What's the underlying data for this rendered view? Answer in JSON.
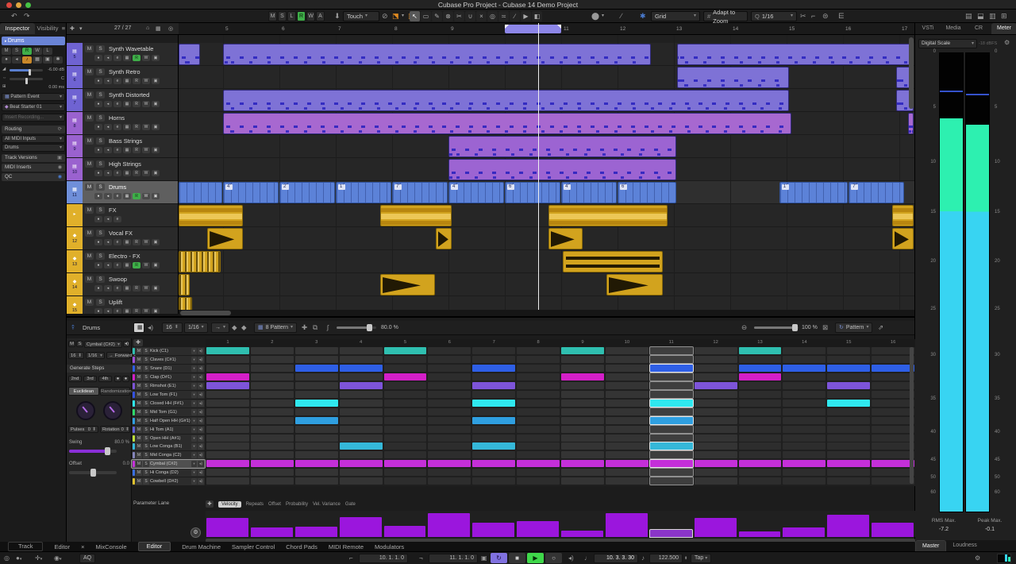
{
  "titlebar": {
    "title": "Cubase Pro Project - Cubase 14 Demo Project"
  },
  "toolbar": {
    "automation": [
      "M",
      "S",
      "L",
      "R",
      "W",
      "A"
    ],
    "active_automation_index": 3,
    "touch_mode": "Touch",
    "grid_mode": "Grid",
    "adapt_mode": "Adapt to Zoom",
    "quantize": "1/16",
    "tools": [
      {
        "name": "object-selection-tool",
        "glyph": "↖",
        "active": true
      },
      {
        "name": "range-selection-tool",
        "glyph": "▭",
        "active": false
      },
      {
        "name": "draw-tool",
        "glyph": "✎",
        "active": false
      },
      {
        "name": "erase-tool",
        "glyph": "⊗",
        "active": false
      },
      {
        "name": "split-tool",
        "glyph": "✂",
        "active": false
      },
      {
        "name": "glue-tool",
        "glyph": "∪",
        "active": false
      },
      {
        "name": "mute-tool",
        "glyph": "×",
        "active": false
      },
      {
        "name": "zoom-tool",
        "glyph": "◎",
        "active": false
      },
      {
        "name": "comp-tool",
        "glyph": "≍",
        "active": false
      },
      {
        "name": "line-tool",
        "glyph": "∕",
        "active": false
      },
      {
        "name": "play-tool",
        "glyph": "▶",
        "active": false
      },
      {
        "name": "color-tool",
        "glyph": "◧",
        "active": false
      }
    ]
  },
  "inspector": {
    "tab_inspector": "Inspector",
    "tab_visibility": "Visibility",
    "track_title": "Drums",
    "buttons": [
      "M",
      "S",
      "R",
      "W",
      "L"
    ],
    "buttons2": [
      "●",
      "◂",
      "♪",
      "▦",
      "▣",
      "✱"
    ],
    "volume": "-6.00 dB",
    "pan": "C",
    "delay": "0.00 ms",
    "pattern_event": "Pattern Event",
    "preset": "Beat Starter 01",
    "insert_recording": "Insert Recording...",
    "routing": "Routing",
    "input": "All MIDI Inputs",
    "output": "Drums",
    "track_versions": "Track Versions",
    "midi_inserts": "MIDI Inserts",
    "qc": "QC"
  },
  "project": {
    "counter": "27 / 27",
    "ruler_bars": [
      "5",
      "6",
      "7",
      "8",
      "9",
      "10",
      "11",
      "12",
      "13",
      "14",
      "15",
      "16",
      "17"
    ],
    "cycle": {
      "from": 10,
      "to": 11
    },
    "playhead_bar": 10.59,
    "ms": [
      "M",
      "S"
    ],
    "subs": [
      "●",
      "◂",
      "e",
      "▦",
      "R",
      "W",
      "▣"
    ],
    "tracks": [
      {
        "num": "5",
        "name": "Synth Wavetable",
        "color": "#6f63d2",
        "kind": "midi",
        "pcolor": "#7e72d6",
        "selected": false,
        "rec": true,
        "parts": [
          {
            "s": 4.17,
            "e": 4.6
          },
          {
            "s": 5,
            "e": 12.6
          },
          {
            "s": 13.05,
            "e": 17.27
          }
        ]
      },
      {
        "num": "6",
        "name": "Synth Retro",
        "color": "#6f63d2",
        "kind": "midi",
        "pcolor": "#7e72d6",
        "selected": false,
        "rec": false,
        "parts": [
          {
            "s": 13.05,
            "e": 15.05
          },
          {
            "s": 16.95,
            "e": 17.27
          }
        ]
      },
      {
        "num": "7",
        "name": "Synth Distorted",
        "color": "#6f63d2",
        "kind": "midi",
        "pcolor": "#7e72d6",
        "selected": false,
        "rec": false,
        "parts": [
          {
            "s": 5,
            "e": 15.05
          },
          {
            "s": 16.95,
            "e": 17.27
          }
        ]
      },
      {
        "num": "8",
        "name": "Horns",
        "color": "#9a62cf",
        "kind": "midi",
        "pcolor": "#a768d0",
        "selected": false,
        "rec": false,
        "parts": [
          {
            "s": 5,
            "e": 15.1
          },
          {
            "s": 17.15,
            "e": 17.27
          }
        ]
      },
      {
        "num": "9",
        "name": "Bass Strings",
        "color": "#9a62cf",
        "kind": "midi",
        "pcolor": "#9c64d2",
        "selected": false,
        "rec": false,
        "parts": [
          {
            "s": 9,
            "e": 13.05
          }
        ]
      },
      {
        "num": "10",
        "name": "High Strings",
        "color": "#9a62cf",
        "kind": "midi",
        "pcolor": "#9c64d2",
        "selected": false,
        "rec": false,
        "parts": [
          {
            "s": 9,
            "e": 13.05
          }
        ]
      },
      {
        "num": "11",
        "name": "Drums",
        "color": "#6f8fd9",
        "kind": "pattern",
        "pcolor": "#5c82d8",
        "selected": true,
        "rec": true,
        "parts": [
          {
            "s": 4.17,
            "e": 5
          },
          {
            "s": 5,
            "e": 6,
            "label": "4˚"
          },
          {
            "s": 6,
            "e": 7,
            "label": "2˚"
          },
          {
            "s": 7,
            "e": 8,
            "label": "1˚"
          },
          {
            "s": 8,
            "e": 9,
            "label": "7˚"
          },
          {
            "s": 9,
            "e": 10,
            "label": "4˚"
          },
          {
            "s": 10,
            "e": 11,
            "label": "6˚"
          },
          {
            "s": 11,
            "e": 12,
            "label": "4˚"
          },
          {
            "s": 12,
            "e": 13.05,
            "label": "6˚"
          },
          {
            "s": 14.87,
            "e": 16.1,
            "label": "1˚"
          },
          {
            "s": 16.1,
            "e": 17.1,
            "label": "7˚"
          }
        ]
      },
      {
        "num": "",
        "name": "FX",
        "color": "#e0b02a",
        "kind": "folder",
        "pcolor": "#d2a31e",
        "selected": false,
        "rec": false,
        "parts": [
          {
            "s": 4.17,
            "e": 5.37,
            "tex": "bands"
          },
          {
            "s": 7.79,
            "e": 9.07,
            "tex": "bands"
          },
          {
            "s": 10.77,
            "e": 12.9,
            "tex": "bands"
          },
          {
            "s": 16.87,
            "e": 17.27,
            "tex": "bands"
          }
        ]
      },
      {
        "num": "12",
        "name": "Vocal FX",
        "color": "#e0b02a",
        "kind": "audio",
        "pcolor": "#d2a31e",
        "selected": false,
        "rec": false,
        "parts": [
          {
            "s": 4.72,
            "e": 5.37,
            "tex": "wedge"
          },
          {
            "s": 8.77,
            "e": 9.07,
            "tex": "wedge"
          },
          {
            "s": 10.77,
            "e": 11.4,
            "tex": "wedge"
          },
          {
            "s": 16.87,
            "e": 17.27,
            "tex": "wedge"
          }
        ]
      },
      {
        "num": "13",
        "name": "Electro - FX",
        "color": "#e0b02a",
        "kind": "audio",
        "pcolor": "#d2a31e",
        "selected": false,
        "rec": true,
        "parts": [
          {
            "s": 4.17,
            "e": 4.97,
            "tex": "stripes"
          },
          {
            "s": 11.03,
            "e": 12.82,
            "tex": "wave"
          }
        ]
      },
      {
        "num": "14",
        "name": "Swoop",
        "color": "#e0b02a",
        "kind": "audio",
        "pcolor": "#d2a31e",
        "selected": false,
        "rec": false,
        "parts": [
          {
            "s": 4.17,
            "e": 4.42,
            "tex": "stripes"
          },
          {
            "s": 7.79,
            "e": 8.77,
            "tex": "wedge"
          },
          {
            "s": 11.8,
            "e": 12.82,
            "tex": "wedge"
          }
        ]
      },
      {
        "num": "15",
        "name": "Uplift",
        "color": "#e0b02a",
        "kind": "audio",
        "pcolor": "#d2a31e",
        "selected": false,
        "rec": false,
        "parts": [
          {
            "s": 4.17,
            "e": 4.46,
            "tex": "stripes"
          }
        ]
      }
    ]
  },
  "right_zone": {
    "tabs": [
      {
        "label": "VSTi"
      },
      {
        "label": "Media"
      },
      {
        "label": "CR"
      },
      {
        "label": "Meter",
        "active": true
      }
    ],
    "scale": "Digital Scale",
    "dbfs": "-18 dBFS",
    "ticks": [
      {
        "v": "0",
        "f": 0
      },
      {
        "v": "5",
        "f": 0.121
      },
      {
        "v": "10",
        "f": 0.24
      },
      {
        "v": "15",
        "f": 0.349
      },
      {
        "v": "20",
        "f": 0.456
      },
      {
        "v": "25",
        "f": 0.56
      },
      {
        "v": "30",
        "f": 0.66
      },
      {
        "v": "35",
        "f": 0.755
      },
      {
        "v": "40",
        "f": 0.827
      },
      {
        "v": "45",
        "f": 0.888
      },
      {
        "v": "50",
        "f": 0.926
      },
      {
        "v": "60",
        "f": 0.959
      }
    ],
    "bars": [
      {
        "top": 0.142,
        "split": 0.344,
        "peak": 0.081
      },
      {
        "top": 0.155,
        "split": 0.344,
        "peak": 0.088
      }
    ],
    "rms_label": "RMS Max.",
    "rms_value": "-7.2",
    "peak_label": "Peak Max.",
    "peak_value": "-0.1",
    "bottom_tabs": [
      {
        "label": "Master",
        "active": true
      },
      {
        "label": "Loudness"
      }
    ]
  },
  "editor": {
    "track_label": "Drums",
    "step_count": "16",
    "resolution": "1/16",
    "pattern_bank": "8 Pattern",
    "swing_value": "80.0 %",
    "zoom_value": "100 %",
    "mode": "Pattern",
    "current_step": 11,
    "step_numbers": [
      "1",
      "2",
      "3",
      "4",
      "5",
      "6",
      "7",
      "8",
      "9",
      "10",
      "11",
      "12",
      "13",
      "14",
      "15",
      "16"
    ],
    "ms": [
      "M",
      "S"
    ],
    "panel": {
      "sound": "Cymbal (C#2)",
      "step_count": "16",
      "resolution": "1/16",
      "direction": "Forward",
      "generate": "Generate Steps",
      "nth": [
        "2nd",
        "3rd",
        "4th"
      ],
      "tab_euclidean": "Euclidean",
      "tab_random": "Randomization",
      "pulses_label": "Pulses",
      "pulses_value": "0",
      "rotation_label": "Rotation",
      "rotation_value": "0",
      "swing_label": "Swing",
      "swing_value": "80.0 %",
      "offset_label": "Offset",
      "offset_value": "0.0"
    },
    "drums": [
      {
        "name": "Kick (C1)",
        "color": "#2fbfb0",
        "steps": [
          1,
          5,
          9,
          13
        ]
      },
      {
        "name": "Claves (C#1)",
        "color": "#9e4fd9",
        "steps": []
      },
      {
        "name": "Snare (D1)",
        "color": "#2e5fe6",
        "steps": [
          3,
          4,
          7,
          11,
          13,
          14,
          15,
          16
        ]
      },
      {
        "name": "Clap (D#1)",
        "color": "#d41fc8",
        "steps": [
          1,
          5,
          9,
          13
        ]
      },
      {
        "name": "Rimshot (E1)",
        "color": "#7d54d9",
        "steps": [
          1,
          4,
          7,
          12,
          15
        ]
      },
      {
        "name": "Low Tom (F1)",
        "color": "#3452e0",
        "steps": []
      },
      {
        "name": "Closed HH (F#1)",
        "color": "#2fe8ef",
        "steps": [
          3,
          7,
          11,
          15
        ]
      },
      {
        "name": "Mid Tom (G1)",
        "color": "#2fd96a",
        "steps": []
      },
      {
        "name": "Half Open HH (G#1)",
        "color": "#2f9fe0",
        "steps": [
          3,
          7,
          11
        ]
      },
      {
        "name": "Hi Tom (A1)",
        "color": "#5f5fd9",
        "steps": []
      },
      {
        "name": "Open HH (A#1)",
        "color": "#bfdf3a",
        "steps": []
      },
      {
        "name": "Low Conga (B1)",
        "color": "#35b8d9",
        "steps": [
          4,
          7,
          11
        ]
      },
      {
        "name": "Mid Conga (C2)",
        "color": "#8585bb",
        "steps": []
      },
      {
        "name": "Cymbal (C#2)",
        "color": "#c42fd9",
        "selected": true,
        "steps": [
          1,
          2,
          3,
          4,
          5,
          6,
          7,
          8,
          9,
          10,
          11,
          12,
          13,
          14,
          15,
          16
        ]
      },
      {
        "name": "Hi Conga (D2)",
        "color": "#3a6fe0",
        "steps": []
      },
      {
        "name": "Cowbell (D#2)",
        "color": "#e0c22f",
        "steps": []
      }
    ],
    "param": {
      "label": "Parameter Lane",
      "tabs": [
        "Velocity",
        "Repeats",
        "Offset",
        "Probability",
        "Vel. Variance",
        "Gate"
      ],
      "active_tab": "Velocity",
      "values": [
        72,
        35,
        40,
        75,
        42,
        92,
        55,
        62,
        25,
        92,
        28,
        72,
        22,
        35,
        85,
        55
      ]
    }
  },
  "bottom_tabs": [
    {
      "label": "Track",
      "boxed": true
    },
    {
      "label": "Editor"
    },
    {
      "label": "×"
    },
    {
      "label": "MixConsole"
    },
    {
      "label": "Editor",
      "active": true
    },
    {
      "label": "Drum Machine"
    },
    {
      "label": "Sampler Control"
    },
    {
      "label": "Chord Pads"
    },
    {
      "label": "MIDI Remote"
    },
    {
      "label": "Modulators"
    }
  ],
  "transport": {
    "aq": "AQ",
    "left_locator": "10. 1. 1.  0",
    "right_locator": "11. 1. 1.  0",
    "position": "10. 3. 3. 30",
    "tempo": "122.500",
    "tap": "Tap"
  },
  "colors": {
    "accent": "#4a7bd0",
    "play_green": "#3fd84a",
    "cycle_purple": "#8071e0",
    "meter_green": "#2df0b0",
    "meter_cyan": "#38d4f2",
    "velocity": "#9b16dd",
    "velocity_current": "#8a35c8"
  }
}
